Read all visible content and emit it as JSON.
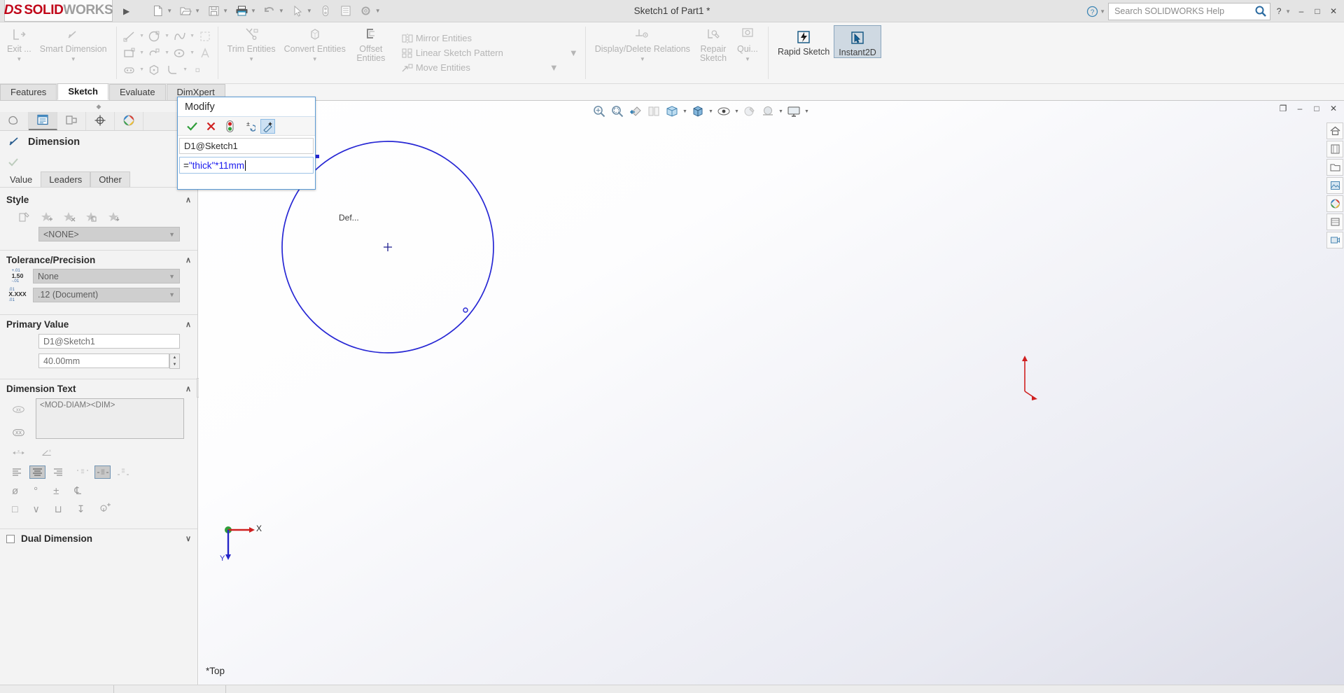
{
  "titlebar": {
    "logo_ds": "DS",
    "logo_solid": "SOLID",
    "logo_works": "WORKS",
    "menu_arrow": "▶",
    "document_title": "Sketch1 of Part1 *",
    "search_placeholder": "Search SOLIDWORKS Help",
    "help_icon": "?",
    "minimize": "–",
    "maximize": "□",
    "close": "✕",
    "quick_access": [
      {
        "name": "new-document",
        "glyph": "὜B",
        "caret": true
      },
      {
        "name": "open-document",
        "glyph": "open",
        "caret": true
      },
      {
        "name": "save-document",
        "glyph": "save",
        "caret": true
      },
      {
        "name": "print-document",
        "glyph": "print",
        "caret": true
      },
      {
        "name": "undo",
        "glyph": "undo",
        "caret": true
      },
      {
        "name": "select",
        "glyph": "cursor",
        "caret": true
      },
      {
        "name": "rebuild",
        "glyph": "rebuild",
        "caret": false
      },
      {
        "name": "options",
        "glyph": "options",
        "caret": false
      },
      {
        "name": "settings",
        "glyph": "gear",
        "caret": true
      }
    ]
  },
  "ribbon": {
    "groups": [
      {
        "name": "exit-group",
        "buttons": [
          {
            "label": "Exit ...",
            "icon": "exit-sketch-icon",
            "dropdown": true,
            "enabled": false
          },
          {
            "label": "Smart Dimension",
            "icon": "smart-dimension-icon",
            "dropdown": true,
            "enabled": false
          }
        ]
      },
      {
        "name": "sketch-entities-group",
        "rows": [
          [
            "line-icon",
            "circle-icon",
            "spline-icon",
            "sketch-fillet-box-icon"
          ],
          [
            "rectangle-icon",
            "slot-icon",
            "ellipse-icon",
            "text-icon"
          ],
          [
            "slot-straight-icon",
            "polygon-icon",
            "arc-tangent-icon",
            "point-icon"
          ]
        ]
      },
      {
        "name": "modify-group",
        "buttons": [
          {
            "label": "Trim Entities",
            "icon": "trim-entities-icon",
            "dropdown": true,
            "enabled": false
          },
          {
            "label": "Convert Entities",
            "icon": "convert-entities-icon",
            "dropdown": true,
            "enabled": false
          },
          {
            "label": "Offset Entities",
            "icon": "offset-entities-icon",
            "dropdown": false,
            "enabled": false
          }
        ]
      },
      {
        "name": "pattern-group",
        "items": [
          {
            "label": "Mirror Entities",
            "icon": "mirror-entities-icon"
          },
          {
            "label": "Linear Sketch Pattern",
            "icon": "linear-sketch-pattern-icon",
            "dropdown": true
          },
          {
            "label": "Move Entities",
            "icon": "move-entities-icon",
            "dropdown": true
          }
        ]
      },
      {
        "name": "relations-group",
        "buttons": [
          {
            "label": "Display/Delete Relations",
            "icon": "display-delete-relations-icon",
            "dropdown": true,
            "enabled": false
          },
          {
            "label": "Repair Sketch",
            "icon": "repair-sketch-icon",
            "dropdown": false,
            "enabled": false
          },
          {
            "label": "Qui...",
            "icon": "quick-snaps-icon",
            "dropdown": true,
            "enabled": false
          }
        ]
      },
      {
        "name": "tools-group",
        "buttons": [
          {
            "label": "Rapid Sketch",
            "icon": "rapid-sketch-icon",
            "dropdown": false,
            "enabled": true
          },
          {
            "label": "Instant2D",
            "icon": "instant2d-icon",
            "dropdown": false,
            "enabled": true,
            "active": true
          }
        ]
      }
    ]
  },
  "tabs": [
    {
      "label": "Features",
      "selected": false
    },
    {
      "label": "Sketch",
      "selected": true
    },
    {
      "label": "Evaluate",
      "selected": false
    },
    {
      "label": "DimXpert",
      "selected": false
    }
  ],
  "property_manager": {
    "tabs": [
      {
        "name": "feature-manager-tab",
        "icon": "feature-tree-icon",
        "selected": false
      },
      {
        "name": "property-manager-tab",
        "icon": "property-list-icon",
        "selected": true
      },
      {
        "name": "configuration-manager-tab",
        "icon": "configuration-icon",
        "selected": false
      },
      {
        "name": "dimxpert-manager-tab",
        "icon": "dimxpert-target-icon",
        "selected": false
      },
      {
        "name": "display-manager-tab",
        "icon": "display-sphere-icon",
        "selected": false
      }
    ],
    "title": "Dimension",
    "title_icon": "dimension-icon",
    "ok_icon": "checkmark-icon",
    "value_tabs": [
      {
        "label": "Value",
        "selected": true
      },
      {
        "label": "Leaders",
        "selected": false
      },
      {
        "label": "Other",
        "selected": false
      }
    ],
    "style": {
      "heading": "Style",
      "collapse": "∧",
      "icons": [
        "apply-style-icon",
        "add-style-icon",
        "delete-style-icon",
        "save-style-icon",
        "load-style-icon"
      ],
      "combo_value": "<NONE>"
    },
    "tolerance": {
      "heading": "Tolerance/Precision",
      "collapse": "∧",
      "type_value": "None",
      "type_icon_top": "+.01",
      "type_icon_mid": "1.50",
      "type_icon_bot": "-.01",
      "precision_value": ".12 (Document)",
      "prec_icon_top": ".01",
      "prec_icon_mid": "X.XXX",
      "prec_icon_bot": ".01"
    },
    "primary_value": {
      "heading": "Primary Value",
      "collapse": "∧",
      "name_value": "D1@Sketch1",
      "value": "40.00mm"
    },
    "dimension_text": {
      "heading": "Dimension Text",
      "collapse": "∧",
      "text": "<MOD-DIAM><DIM>",
      "left_icons": [
        "add-symbol-icon",
        "more-symbols-icon"
      ],
      "extra_icons": [
        "dim-offset-icon",
        "dim-slant-icon"
      ],
      "align_buttons": [
        {
          "name": "align-left-button",
          "icon": "align-left-icon",
          "active": false
        },
        {
          "name": "align-center-button",
          "icon": "align-center-icon",
          "active": true
        },
        {
          "name": "align-right-button",
          "icon": "align-right-icon",
          "active": false
        },
        {
          "name": "text-above-button",
          "icon": "text-above-icon",
          "active": false
        },
        {
          "name": "text-center-button",
          "icon": "text-center-icon",
          "active": true
        },
        {
          "name": "text-below-button",
          "icon": "text-below-icon",
          "active": false
        }
      ],
      "symbol_row_1": [
        {
          "name": "diameter-symbol-button",
          "glyph": "ø"
        },
        {
          "name": "degree-symbol-button",
          "glyph": "°"
        },
        {
          "name": "plusminus-symbol-button",
          "glyph": "±"
        },
        {
          "name": "centerline-symbol-button",
          "glyph": "℄"
        }
      ],
      "symbol_row_2": [
        {
          "name": "square-symbol-button",
          "glyph": "□"
        },
        {
          "name": "countersink-symbol-button",
          "glyph": "∨"
        },
        {
          "name": "counterbore-symbol-button",
          "glyph": "⊔"
        },
        {
          "name": "depth-symbol-button",
          "glyph": "↧"
        },
        {
          "name": "more-symbols-button",
          "glyph": "more"
        }
      ]
    },
    "dual_dimension": {
      "heading": "Dual Dimension",
      "checked": false,
      "collapse": "∨"
    }
  },
  "modify_dialog": {
    "title": "Modify",
    "buttons": [
      {
        "name": "accept-button",
        "icon": "green-check-icon"
      },
      {
        "name": "cancel-button",
        "icon": "red-x-icon"
      },
      {
        "name": "rebuild-button",
        "icon": "traffic-light-icon"
      },
      {
        "name": "reverse-direction-button",
        "icon": "plus-minus-undo-icon"
      },
      {
        "name": "mark-for-drawing-button",
        "icon": "mark-drawing-icon",
        "selected": true
      }
    ],
    "name_field": "D1@Sketch1",
    "value_prefix": "=",
    "value_expression": "\"thick\"*11mm"
  },
  "graphics": {
    "view_toolbar": [
      {
        "name": "zoom-to-fit-icon",
        "caret": false
      },
      {
        "name": "zoom-to-area-icon",
        "caret": false
      },
      {
        "name": "previous-view-icon",
        "caret": false
      },
      {
        "name": "section-view-icon",
        "caret": false
      },
      {
        "name": "view-orientation-icon",
        "caret": true
      },
      {
        "name": "display-style-icon",
        "caret": true
      },
      {
        "name": "hide-show-items-icon",
        "caret": true
      },
      {
        "name": "edit-appearance-icon",
        "caret": false
      },
      {
        "name": "apply-scene-icon",
        "caret": true
      },
      {
        "name": "view-settings-icon",
        "caret": true
      }
    ],
    "window_buttons": [
      {
        "name": "restore-pane-icon",
        "glyph": "❐"
      },
      {
        "name": "minimize-doc-icon",
        "glyph": "–"
      },
      {
        "name": "maximize-doc-icon",
        "glyph": "□"
      },
      {
        "name": "close-doc-icon",
        "glyph": "✕"
      }
    ],
    "axis_x_label": "X",
    "axis_y_label": "Y",
    "plane_label": "*Top",
    "partial_text": "Def..."
  },
  "right_strip": [
    {
      "name": "view-home-icon"
    },
    {
      "name": "appearances-icon"
    },
    {
      "name": "open-folder-icon"
    },
    {
      "name": "decals-icon"
    },
    {
      "name": "scenes-icon"
    },
    {
      "name": "lights-icon"
    },
    {
      "name": "cameras-icon"
    }
  ]
}
